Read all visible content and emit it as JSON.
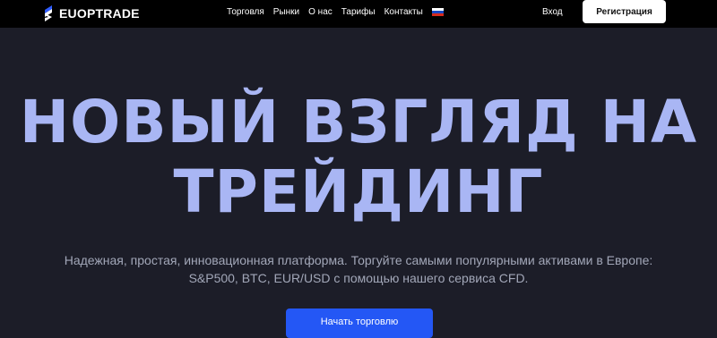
{
  "header": {
    "logo_text": "EUOPTRADE",
    "nav": [
      "Торговля",
      "Рынки",
      "О нас",
      "Тарифы",
      "Контакты"
    ],
    "language_icon": "russia-flag-icon",
    "login_label": "Вход",
    "register_label": "Регистрация"
  },
  "hero": {
    "title_line1": "НОВЫЙ ВЗГЛЯД НА",
    "title_line2": "ТРЕЙДИНГ",
    "subtitle_line1": "Надежная, простая, инновационная платформа. Торгуйте самыми популярными активами в Европе:",
    "subtitle_line2": "S&P500, BTC, EUR/USD с помощью нашего сервиса CFD.",
    "cta_label": "Начать торговлю"
  },
  "colors": {
    "background": "#1c1d28",
    "header": "#000000",
    "title": "#a9b6f4",
    "cta": "#2457f5"
  }
}
